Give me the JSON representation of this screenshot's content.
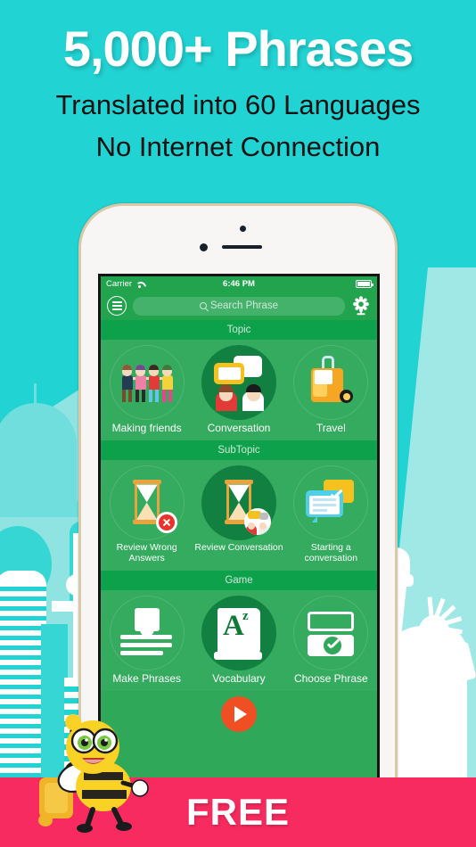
{
  "hero": {
    "title": "5,000+ Phrases",
    "subtitle1": "Translated into 60 Languages",
    "subtitle2": "No Internet Connection"
  },
  "banner": {
    "label": "FREE",
    "color": "#f72b5f"
  },
  "colors": {
    "background_teal": "#22d3d3",
    "app_green": "#2fa85a",
    "section_header_green": "#0da14b",
    "tile_green": "#34ab5e",
    "active_tile_green": "#128040",
    "play_button": "#f04e23"
  },
  "phone": {
    "status_bar": {
      "carrier": "Carrier",
      "wifi_icon": "wifi-icon",
      "time": "6:46 PM",
      "battery_icon": "battery-icon"
    },
    "nav_bar": {
      "menu_icon": "hamburger-menu-icon",
      "search_placeholder": "Search Phrase",
      "search_icon": "search-icon",
      "settings_icon": "gear-icon"
    },
    "sections": [
      {
        "header": "Topic",
        "items": [
          {
            "label": "Making friends",
            "icon": "people-group-icon",
            "active": false
          },
          {
            "label": "Conversation",
            "icon": "speech-bubbles-icon",
            "active": true
          },
          {
            "label": "Travel",
            "icon": "suitcase-icon",
            "active": false
          }
        ]
      },
      {
        "header": "SubTopic",
        "items": [
          {
            "label": "Review Wrong Answers",
            "icon": "hourglass-error-icon",
            "active": false
          },
          {
            "label": "Review Conversation",
            "icon": "hourglass-conversation-icon",
            "active": true
          },
          {
            "label": "Starting a conversation",
            "icon": "chat-check-icon",
            "active": false
          }
        ]
      },
      {
        "header": "Game",
        "items": [
          {
            "label": "Make Phrases",
            "icon": "make-phrases-icon",
            "active": false
          },
          {
            "label": "Vocabulary",
            "icon": "dictionary-book-icon",
            "active": true
          },
          {
            "label": "Choose Phrase",
            "icon": "choose-phrase-icon",
            "active": false
          }
        ]
      }
    ],
    "play_button_icon": "play-icon"
  },
  "decorations": {
    "mascot": "bee-mascot-with-suitcase",
    "skyline_left": "city-skyline-silhouette",
    "landmark_right": "statue-of-liberty-silhouette"
  }
}
